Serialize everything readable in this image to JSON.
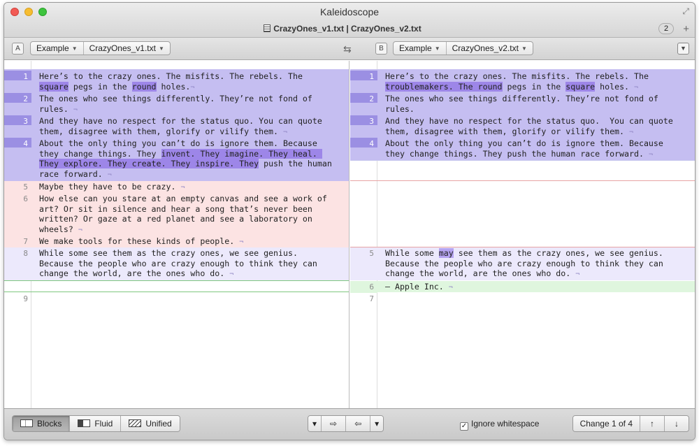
{
  "window": {
    "app_title": "Kaleidoscope",
    "tab_title": "CrazyOnes_v1.txt | CrazyOnes_v2.txt",
    "tab_count": "2",
    "add_tab": "+",
    "fullscreen_icon": "fullscreen-icon"
  },
  "pathbar": {
    "left": {
      "badge": "A",
      "folder": "Example",
      "file": "CrazyOnes_v1.txt"
    },
    "right": {
      "badge": "B",
      "folder": "Example",
      "file": "CrazyOnes_v2.txt"
    },
    "swap_icon": "⇆",
    "filter_icon": "▼"
  },
  "left": {
    "n1": "1",
    "n2": "2",
    "n3": "3",
    "n4": "4",
    "n5": "5",
    "n6": "6",
    "n7": "7",
    "n8": "8",
    "n9": "9",
    "l1a": "Here’s to the crazy ones. The misfits. The rebels. The ",
    "l1b": "square",
    "l1c": " pegs in the ",
    "l1d": "round",
    "l1e": " holes.",
    "l2": "The ones who see things differently. They’re not fond of rules.",
    "l3": "And they have no respect for the status quo. You can quote them, disagree with them, glorify or vilify them.",
    "l4a": "About the only thing you can’t do is ignore them. Because they change things. They ",
    "l4b": "invent. They imagine. They heal. They explore. They create. They inspire. They",
    "l4c": " push the human race forward.",
    "l5": "Maybe they have to be crazy.",
    "l6": "How else can you stare at an empty canvas and see a work of art? Or sit in silence and hear a song that’s never been written? Or gaze at a red planet and see a laboratory on wheels?",
    "l7": "We make tools for these kinds of people.",
    "l8": "While some see them as the crazy ones, we see genius. Because the people who are crazy enough to think they can change the world, are the ones who do."
  },
  "right": {
    "n1": "1",
    "n2": "2",
    "n3": "3",
    "n4": "4",
    "n5": "5",
    "n6": "6",
    "n7": "7",
    "r1a": "Here’s to the crazy ones. The misfits. The rebels. The ",
    "r1b": "troublemakers. The round",
    "r1c": " pegs in the ",
    "r1d": "square",
    "r1e": " holes.",
    "r2": "The ones who see things differently. They’re not fond of rules.",
    "r3": "And they have no respect for the status quo.  You can quote them, disagree with them, glorify or vilify them.",
    "r4": "About the only thing you can’t do is ignore them. Because they change things. They push the human race forward.",
    "r5a": "While some ",
    "r5b": "may",
    "r5c": " see them as the crazy ones, we see genius. Because the people who are crazy enough to think they can change the world, are the ones who do.",
    "r6": "— Apple Inc."
  },
  "pilcrow": "¬",
  "bottom": {
    "modes": [
      "Blocks",
      "Fluid",
      "Unified"
    ],
    "merge_left": "▾",
    "merge_a_to_b": "⇨",
    "merge_b_to_a": "⇦",
    "merge_right": "▾",
    "ignore_whitespace": "Ignore whitespace",
    "ignore_checked": "✓",
    "change_label": "Change 1 of 4",
    "prev": "↑",
    "next": "↓"
  },
  "colors": {
    "changed": "#c5bef1",
    "changed_gutter": "#9b8fe3",
    "deleted": "#fce3e3",
    "inserted": "#dff6de",
    "modified": "#ece9fc",
    "highlight": "#9d86e8"
  }
}
